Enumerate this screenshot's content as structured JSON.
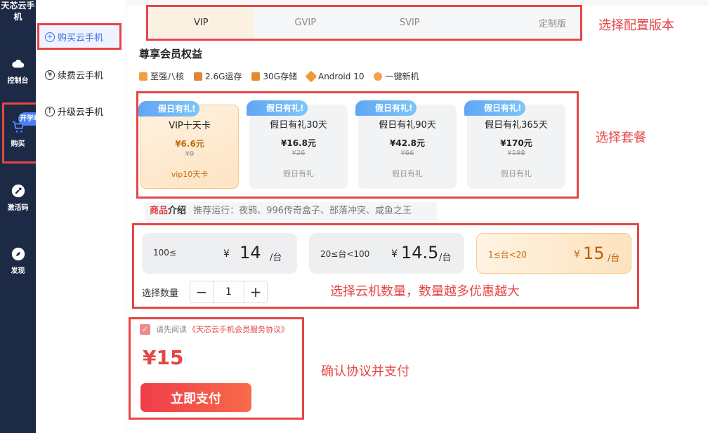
{
  "sidebar": {
    "app_title": "天芯云手机",
    "items": [
      {
        "label": "控制台",
        "icon": "cloud-icon"
      },
      {
        "label": "购买",
        "icon": "cart-icon"
      },
      {
        "label": "激活码",
        "icon": "key-icon"
      },
      {
        "label": "发现",
        "icon": "compass-icon"
      }
    ],
    "cart_badge": "开学季"
  },
  "menu": {
    "items": [
      {
        "label": "购买云手机"
      },
      {
        "label": "续费云手机"
      },
      {
        "label": "升级云手机"
      }
    ]
  },
  "tabs": [
    "VIP",
    "GVIP",
    "SVIP",
    "定制版"
  ],
  "benefits": {
    "title": "尊享会员权益",
    "items": [
      "至强八核",
      "2.6G运存",
      "30G存储",
      "Android 10",
      "一键新机"
    ]
  },
  "packages": [
    {
      "tag": "假日有礼!",
      "name": "VIP十天卡",
      "price": "¥6.6元",
      "original": "¥9",
      "note": "vip10天卡"
    },
    {
      "tag": "假日有礼!",
      "name": "假日有礼30天",
      "price": "¥16.8元",
      "original": "¥26",
      "note": "假日有礼"
    },
    {
      "tag": "假日有礼!",
      "name": "假日有礼90天",
      "price": "¥42.8元",
      "original": "¥66",
      "note": "假日有礼"
    },
    {
      "tag": "假日有礼!",
      "name": "假日有礼365天",
      "price": "¥170元",
      "original": "¥198",
      "note": "假日有礼"
    }
  ],
  "product_intro": {
    "label_a": "商品",
    "label_b": "介绍",
    "text": "推荐运行：夜鸦、996传奇盒子、部落冲突、咸鱼之王"
  },
  "tiers": [
    {
      "range": "100≤",
      "currency": "¥",
      "price": "14",
      "unit": "/台"
    },
    {
      "range": "20≤台<100",
      "currency": "¥",
      "price": "14.5",
      "unit": "/台"
    },
    {
      "range": "1≤台<20",
      "currency": "¥",
      "price": "15",
      "unit": "/台"
    }
  ],
  "quantity": {
    "label": "选择数量",
    "minus": "−",
    "value": "1",
    "plus": "+"
  },
  "agreement": {
    "prefix": "请先阅读",
    "link": "《天芯云手机会员服务协议》"
  },
  "total": "¥15",
  "pay_button": "立即支付",
  "annotations": {
    "tabs": "选择配置版本",
    "packages": "选择套餐",
    "tiers": "选择云机数量，数量越多优惠越大",
    "pay": "确认协议并支付"
  },
  "colors": {
    "accent_red": "#e54646",
    "nav_bg": "#1d2a45",
    "selected_gold": "#c06a10",
    "menu_active": "#3c6fe0"
  }
}
